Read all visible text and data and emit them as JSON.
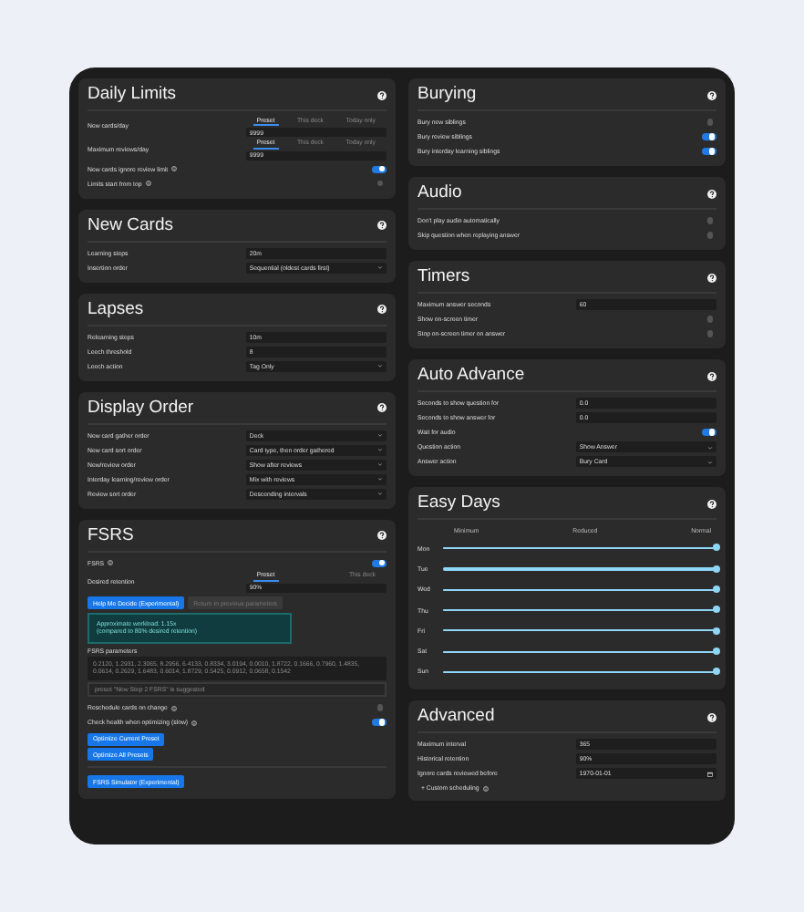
{
  "left": [
    {
      "title": "Daily Limits",
      "rows": [
        {
          "kind": "tabbed",
          "label": "New cards/day",
          "tabs": [
            {
              "label": "Preset",
              "selected": true
            },
            {
              "label": "This deck",
              "selected": false
            },
            {
              "label": "Today only",
              "selected": false
            }
          ],
          "value": "9999"
        },
        {
          "kind": "tabbed",
          "label": "Maximum reviews/day",
          "tabs": [
            {
              "label": "Preset",
              "selected": true
            },
            {
              "label": "This deck",
              "selected": false
            },
            {
              "label": "Today only",
              "selected": false
            }
          ],
          "value": "9999"
        },
        {
          "kind": "toggle",
          "label": "New cards ignore review limit",
          "info": true,
          "on": true
        },
        {
          "kind": "toggle",
          "label": "Limits start from top",
          "info": true,
          "on": false
        }
      ]
    },
    {
      "title": "New Cards",
      "rows": [
        {
          "kind": "input",
          "label": "Learning steps",
          "value": "20m"
        },
        {
          "kind": "select",
          "label": "Insertion order",
          "value": "Sequential (oldest cards first)"
        }
      ]
    },
    {
      "title": "Lapses",
      "rows": [
        {
          "kind": "input",
          "label": "Relearning steps",
          "value": "10m"
        },
        {
          "kind": "input",
          "label": "Leech threshold",
          "value": "8"
        },
        {
          "kind": "select",
          "label": "Leech action",
          "value": "Tag Only"
        }
      ]
    },
    {
      "title": "Display Order",
      "rows": [
        {
          "kind": "select",
          "label": "New card gather order",
          "value": "Deck"
        },
        {
          "kind": "select",
          "label": "New card sort order",
          "value": "Card type, then order gathered"
        },
        {
          "kind": "select",
          "label": "New/review order",
          "value": "Show after reviews"
        },
        {
          "kind": "select",
          "label": "Interday learning/review order",
          "value": "Mix with reviews"
        },
        {
          "kind": "select",
          "label": "Review sort order",
          "value": "Descending intervals"
        }
      ]
    },
    {
      "title": "FSRS",
      "rows": [
        {
          "kind": "toggle",
          "label": "FSRS",
          "info": true,
          "on": true
        },
        {
          "kind": "tabbed",
          "label": "Desired retention",
          "tabs": [
            {
              "label": "Preset",
              "selected": true
            },
            {
              "label": "This deck",
              "selected": false
            }
          ],
          "value": "90%"
        },
        {
          "kind": "buttons",
          "buttons": [
            {
              "label": "Help Me Decide (Experimental)",
              "disabled": false
            },
            {
              "label": "Return to previous parameters",
              "disabled": true
            }
          ]
        },
        {
          "kind": "note",
          "lines": [
            "Approximate workload: 1.15x",
            "(compared to 80% desired retention)"
          ]
        },
        {
          "kind": "textarea",
          "label": "FSRS parameters",
          "value": "0.2120, 1.2931, 2.3065, 8.2956, 6.4133, 0.8334, 3.0194, 0.0010, 1.8722, 0.1666, 0.7960, 1.4835, 0.0614, 0.2629, 1.6483, 0.6014, 1.8729, 0.5425, 0.0912, 0.0658, 0.1542"
        },
        {
          "kind": "hint",
          "value": "preset \"New Step 2 FSRS\" is suggested"
        },
        {
          "kind": "toggle",
          "label": "Reschedule cards on change",
          "info": true,
          "on": false
        },
        {
          "kind": "toggle",
          "label": "Check health when optimizing (slow)",
          "info": true,
          "on": true
        },
        {
          "kind": "buttons",
          "buttons": [
            {
              "label": "Optimize Current Preset",
              "disabled": false
            }
          ]
        },
        {
          "kind": "buttons",
          "buttons": [
            {
              "label": "Optimize All Presets",
              "disabled": false
            }
          ]
        },
        {
          "kind": "divider"
        },
        {
          "kind": "buttons",
          "buttons": [
            {
              "label": "FSRS Simulator (Experimental)",
              "disabled": false
            }
          ]
        }
      ]
    }
  ],
  "right": [
    {
      "title": "Burying",
      "rows": [
        {
          "kind": "toggle",
          "label": "Bury new siblings",
          "info": false,
          "on": false
        },
        {
          "kind": "toggle",
          "label": "Bury review siblings",
          "info": false,
          "on": true
        },
        {
          "kind": "toggle",
          "label": "Bury interday learning siblings",
          "info": false,
          "on": true
        }
      ]
    },
    {
      "title": "Audio",
      "rows": [
        {
          "kind": "toggle",
          "label": "Don't play audio automatically",
          "info": false,
          "on": false
        },
        {
          "kind": "toggle",
          "label": "Skip question when replaying answer",
          "info": false,
          "on": false
        }
      ]
    },
    {
      "title": "Timers",
      "rows": [
        {
          "kind": "input",
          "label": "Maximum answer seconds",
          "value": "60"
        },
        {
          "kind": "toggle",
          "label": "Show on-screen timer",
          "info": false,
          "on": false
        },
        {
          "kind": "toggle",
          "label": "Stop on-screen timer on answer",
          "info": false,
          "on": false
        }
      ]
    },
    {
      "title": "Auto Advance",
      "rows": [
        {
          "kind": "input",
          "label": "Seconds to show question for",
          "value": "0.0"
        },
        {
          "kind": "input",
          "label": "Seconds to show answer for",
          "value": "0.0"
        },
        {
          "kind": "toggle",
          "label": "Wait for audio",
          "info": false,
          "on": true
        },
        {
          "kind": "select",
          "label": "Question action",
          "value": "Show Answer"
        },
        {
          "kind": "select",
          "label": "Answer action",
          "value": "Bury Card"
        }
      ]
    },
    {
      "title": "Easy Days",
      "rows": [
        {
          "kind": "days",
          "scale": [
            "Minimum",
            "Reduced",
            "Normal"
          ],
          "days": [
            {
              "label": "Mon",
              "level": 1
            },
            {
              "label": "Tue",
              "level": 1
            },
            {
              "label": "Wed",
              "level": 1
            },
            {
              "label": "Thu",
              "level": 1
            },
            {
              "label": "Fri",
              "level": 1
            },
            {
              "label": "Sat",
              "level": 1
            },
            {
              "label": "Sun",
              "level": 1
            }
          ]
        }
      ]
    },
    {
      "title": "Advanced",
      "rows": [
        {
          "kind": "input",
          "label": "Maximum interval",
          "value": "365"
        },
        {
          "kind": "input",
          "label": "Historical retention",
          "value": "90%"
        },
        {
          "kind": "date",
          "label": "Ignore cards reviewed before",
          "value": "1970-01-01"
        },
        {
          "kind": "link",
          "label": "+ Custom scheduling",
          "info": true
        }
      ]
    }
  ]
}
